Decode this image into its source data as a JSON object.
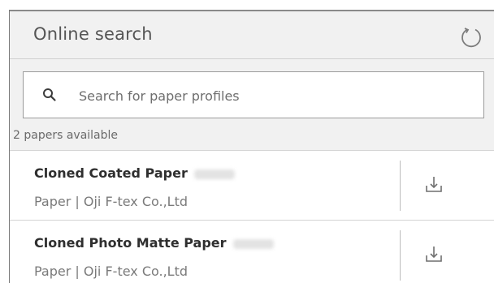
{
  "header": {
    "title": "Online search",
    "refresh_icon": "refresh-icon"
  },
  "search": {
    "icon": "search-icon",
    "placeholder": "Search for paper profiles",
    "value": ""
  },
  "results": {
    "count_label": "2 papers available",
    "items": [
      {
        "title": "Cloned Coated Paper",
        "type": "Paper",
        "separator": "|",
        "vendor": "Oji F-tex Co.,Ltd",
        "action_icon": "download-icon"
      },
      {
        "title": "Cloned Photo Matte Paper",
        "type": "Paper",
        "separator": "|",
        "vendor": "Oji F-tex Co.,Ltd",
        "action_icon": "download-icon"
      }
    ]
  },
  "colors": {
    "panel_bg": "#f1f1f1",
    "row_bg": "#ffffff",
    "title_text": "#555555",
    "muted_text": "#7a7a7a"
  }
}
